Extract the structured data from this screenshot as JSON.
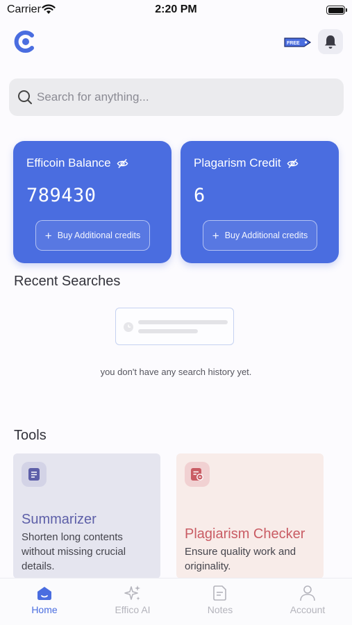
{
  "status_bar": {
    "carrier": "Carrier",
    "time": "2:20 PM"
  },
  "header": {
    "badge_text": "FREE",
    "brand_color": "#4a6de0"
  },
  "search": {
    "placeholder": "Search for anything..."
  },
  "cards": [
    {
      "title": "Efficoin Balance",
      "value": "789430",
      "button_label": "Buy Additional credits"
    },
    {
      "title": "Plagarism Credit",
      "value": "6",
      "button_label": "Buy Additional credits"
    }
  ],
  "recent": {
    "title": "Recent Searches",
    "empty_text": "you don't have any search history yet."
  },
  "tools": {
    "title": "Tools",
    "items": [
      {
        "name": "Summarizer",
        "desc": "Shorten long contents without missing crucial details.",
        "icon": "document-icon",
        "color": "#5d5fa8"
      },
      {
        "name": "Plagiarism Checker",
        "desc": "Ensure quality work and originality.",
        "icon": "document-check-icon",
        "color": "#c95c64"
      }
    ]
  },
  "tabs": [
    {
      "label": "Home",
      "icon": "home-icon",
      "active": true
    },
    {
      "label": "Effico AI",
      "icon": "sparkle-icon",
      "active": false
    },
    {
      "label": "Notes",
      "icon": "notes-icon",
      "active": false
    },
    {
      "label": "Account",
      "icon": "person-icon",
      "active": false
    }
  ]
}
